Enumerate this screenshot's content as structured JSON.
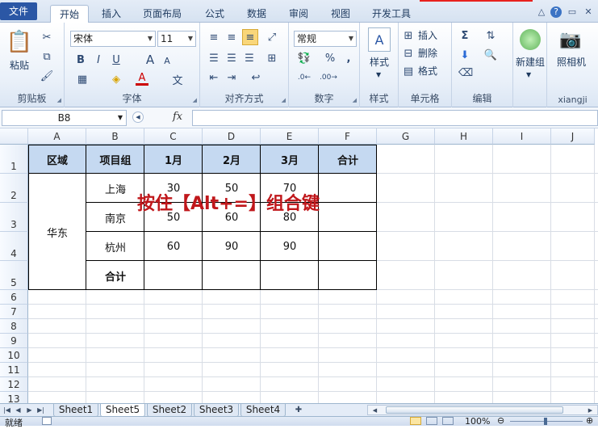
{
  "menubar": {
    "tabs": [
      "文件",
      "开始",
      "插入",
      "页面布局",
      "公式",
      "数据",
      "审阅",
      "视图",
      "开发工具"
    ]
  },
  "ribbon": {
    "clipboard": {
      "label": "剪贴板",
      "paste": "粘贴"
    },
    "font": {
      "label": "字体",
      "name": "宋体",
      "size": "11",
      "bold": "B",
      "italic": "I",
      "underline": "U",
      "grow": "A",
      "shrink": "A",
      "fontcolor": "A",
      "phonetic": "文"
    },
    "alignment": {
      "label": "对齐方式"
    },
    "number": {
      "label": "数字",
      "format": "常规",
      "percent": "%",
      "comma": ","
    },
    "styles": {
      "label": "样式",
      "btn": "样式"
    },
    "cells": {
      "label": "单元格",
      "insert": "插入",
      "delete": "删除",
      "format": "格式"
    },
    "editing": {
      "label": "编辑",
      "sum": "Σ"
    },
    "newgroup": {
      "label": "新建组"
    },
    "camera": {
      "label": "照相机",
      "group": "xiangji"
    }
  },
  "formula": {
    "namebox": "B8",
    "fx": "fx",
    "value": ""
  },
  "columns": [
    "A",
    "B",
    "C",
    "D",
    "E",
    "F",
    "G",
    "H",
    "I",
    "J"
  ],
  "rows": [
    "1",
    "2",
    "3",
    "4",
    "5",
    "6",
    "7",
    "8",
    "9",
    "10",
    "11",
    "12",
    "13"
  ],
  "table": {
    "headers": [
      "区域",
      "项目组",
      "1月",
      "2月",
      "3月",
      "合计"
    ],
    "region": "华东",
    "rows": [
      {
        "group": "上海",
        "m1": "30",
        "m2": "50",
        "m3": "70",
        "total": ""
      },
      {
        "group": "南京",
        "m1": "50",
        "m2": "60",
        "m3": "80",
        "total": ""
      },
      {
        "group": "杭州",
        "m1": "60",
        "m2": "90",
        "m3": "90",
        "total": ""
      },
      {
        "group": "合计",
        "m1": "",
        "m2": "",
        "m3": "",
        "total": ""
      }
    ]
  },
  "overlay": "按住【Alt+=】组合键",
  "sheets": [
    "Sheet1",
    "Sheet5",
    "Sheet2",
    "Sheet3",
    "Sheet4"
  ],
  "status": {
    "ready": "就绪",
    "zoom": "100%"
  },
  "colors": {
    "header_fill": "#c5d9f1",
    "overlay_text": "#c0171b",
    "file_tab": "#2b57a5"
  }
}
